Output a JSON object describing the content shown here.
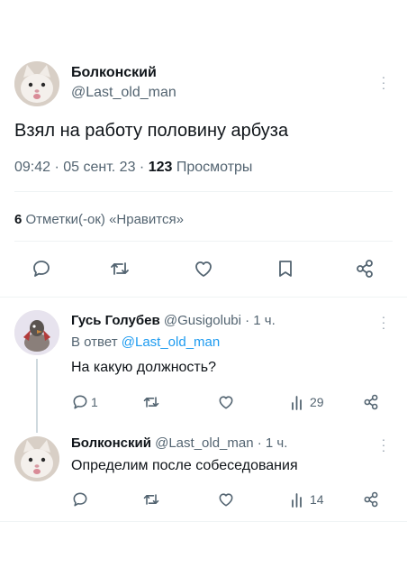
{
  "main_tweet": {
    "author_name": "Болконский",
    "author_handle": "@Last_old_man",
    "text": "Взял на работу половину арбуза",
    "time": "09:42 · 05 сент. 23 · ",
    "views_count": "123",
    "views_label": " Просмотры",
    "likes_count": "6",
    "likes_label": " Отметки(-ок) «Нравится»",
    "avatar_icon": "cat-avatar-icon"
  },
  "reply_1": {
    "author_name": "Гусь Голубев",
    "author_handle": "@Gusigolubi",
    "time": " · 1 ч.",
    "reply_prefix": "В ответ ",
    "reply_to": "@Last_old_man",
    "text": "На какую должность?",
    "reply_count": "1",
    "views_count": "29",
    "avatar_icon": "goose-avatar-icon"
  },
  "reply_2": {
    "author_name": "Болконский",
    "author_handle": "@Last_old_man",
    "time": " · 1 ч.",
    "text": "Определим после собеседования",
    "views_count": "14",
    "avatar_icon": "cat-avatar-icon"
  },
  "colors": {
    "text": "#0f1419",
    "secondary": "#536471",
    "accent": "#1d9bf0",
    "divider": "#eff3f4"
  }
}
